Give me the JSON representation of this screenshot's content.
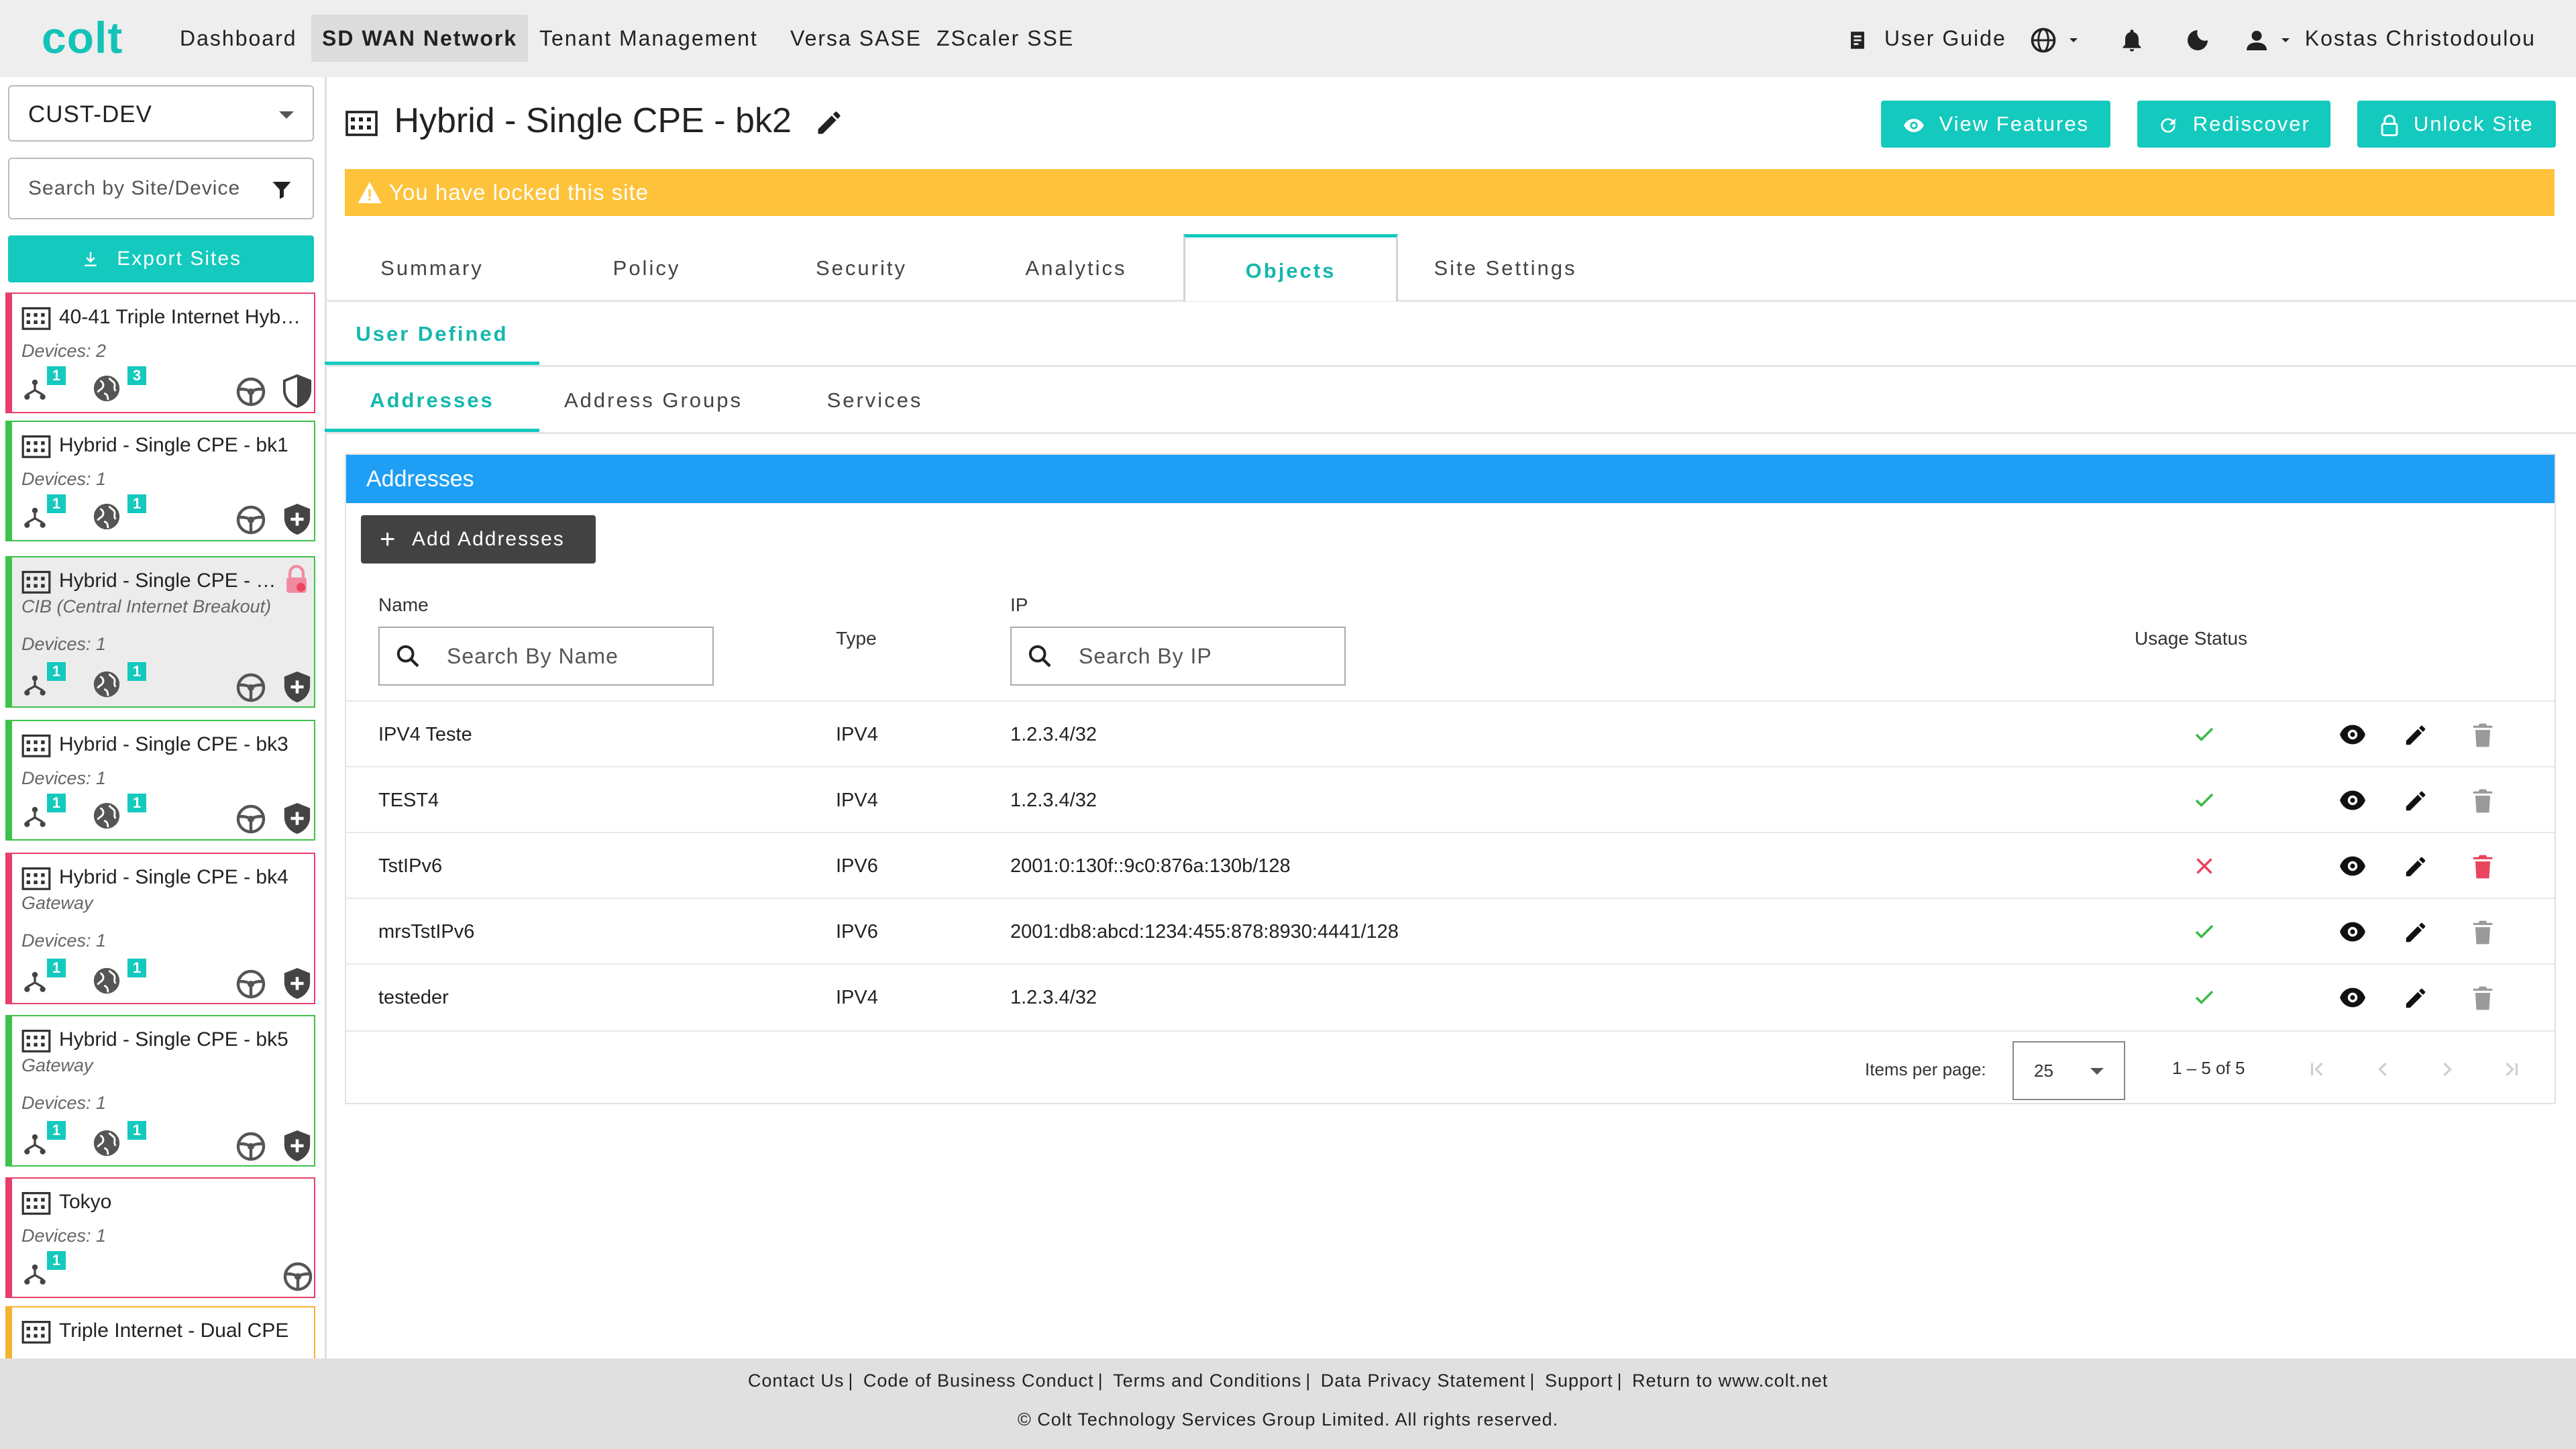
{
  "brand": {
    "logo": "colt",
    "accent": "#14c9bd"
  },
  "nav": {
    "items": [
      "Dashboard",
      "SD WAN Network",
      "Tenant Management",
      "Versa SASE",
      "ZScaler SSE"
    ],
    "active": "SD WAN Network",
    "user_guide": "User Guide",
    "user_name": "Kostas Christodoulou"
  },
  "sidebar": {
    "customer": "CUST-DEV",
    "search_placeholder": "Search by Site/Device",
    "export_label": "Export Sites",
    "sites": [
      {
        "name": "40-41 Triple Internet Hyb…",
        "subtitle": "",
        "devices": "Devices: 2",
        "status": "red",
        "badge_a": "1",
        "badge_b": "3"
      },
      {
        "name": "Hybrid - Single CPE - bk1",
        "subtitle": "",
        "devices": "Devices: 1",
        "status": "green",
        "badge_a": "1",
        "badge_b": "1"
      },
      {
        "name": "Hybrid - Single CPE - …",
        "subtitle": "CIB (Central Internet Breakout)",
        "devices": "Devices: 1",
        "status": "green",
        "badge_a": "1",
        "badge_b": "1",
        "selected": true,
        "locked": true
      },
      {
        "name": "Hybrid - Single CPE - bk3",
        "subtitle": "",
        "devices": "Devices: 1",
        "status": "green",
        "badge_a": "1",
        "badge_b": "1"
      },
      {
        "name": "Hybrid - Single CPE - bk4",
        "subtitle": "Gateway",
        "devices": "Devices: 1",
        "status": "red",
        "badge_a": "1",
        "badge_b": "1"
      },
      {
        "name": "Hybrid - Single CPE - bk5",
        "subtitle": "Gateway",
        "devices": "Devices: 1",
        "status": "green",
        "badge_a": "1",
        "badge_b": "1"
      },
      {
        "name": "Tokyo",
        "subtitle": "",
        "devices": "Devices: 1",
        "status": "red",
        "badge_a": "1"
      },
      {
        "name": "Triple Internet - Dual CPE",
        "subtitle": "",
        "devices": "",
        "status": "orange"
      }
    ]
  },
  "page": {
    "title": "Hybrid - Single CPE - bk2",
    "buttons": {
      "view_features": "View Features",
      "rediscover": "Rediscover",
      "unlock_site": "Unlock Site"
    },
    "lock_banner": "You have locked this site"
  },
  "tabs": [
    "Summary",
    "Policy",
    "Security",
    "Analytics",
    "Objects",
    "Site Settings"
  ],
  "active_tab": "Objects",
  "subtab": "User Defined",
  "subtabs2": [
    "Addresses",
    "Address Groups",
    "Services"
  ],
  "active_subtab2": "Addresses",
  "addresses": {
    "panel_title": "Addresses",
    "add_label": "Add Addresses",
    "columns": {
      "name": "Name",
      "type": "Type",
      "ip": "IP",
      "usage": "Usage Status"
    },
    "name_placeholder": "Search By Name",
    "ip_placeholder": "Search By IP",
    "rows": [
      {
        "name": "IPV4 Teste",
        "type": "IPV4",
        "ip": "1.2.3.4/32",
        "used": true
      },
      {
        "name": "TEST4",
        "type": "IPV4",
        "ip": "1.2.3.4/32",
        "used": true
      },
      {
        "name": "TstIPv6",
        "type": "IPV6",
        "ip": "2001:0:130f::9c0:876a:130b/128",
        "used": false
      },
      {
        "name": "mrsTstIPv6",
        "type": "IPV6",
        "ip": "2001:db8:abcd:1234:455:878:8930:4441/128",
        "used": true
      },
      {
        "name": "testeder",
        "type": "IPV4",
        "ip": "1.2.3.4/32",
        "used": true
      }
    ],
    "pager": {
      "items_per_page_label": "Items per page:",
      "items_per_page": "25",
      "range": "1 – 5 of 5"
    }
  },
  "footer": {
    "links": [
      "Contact Us",
      "Code of Business Conduct",
      "Terms and Conditions",
      "Data Privacy Statement",
      "Support",
      "Return to www.colt.net"
    ],
    "copyright": "© Colt Technology Services Group Limited. All rights reserved."
  },
  "colors": {
    "locked_banner": "#fec33b",
    "panel_header": "#1e9ef4",
    "ok": "#3dbb4a",
    "fail": "#e8455f"
  }
}
